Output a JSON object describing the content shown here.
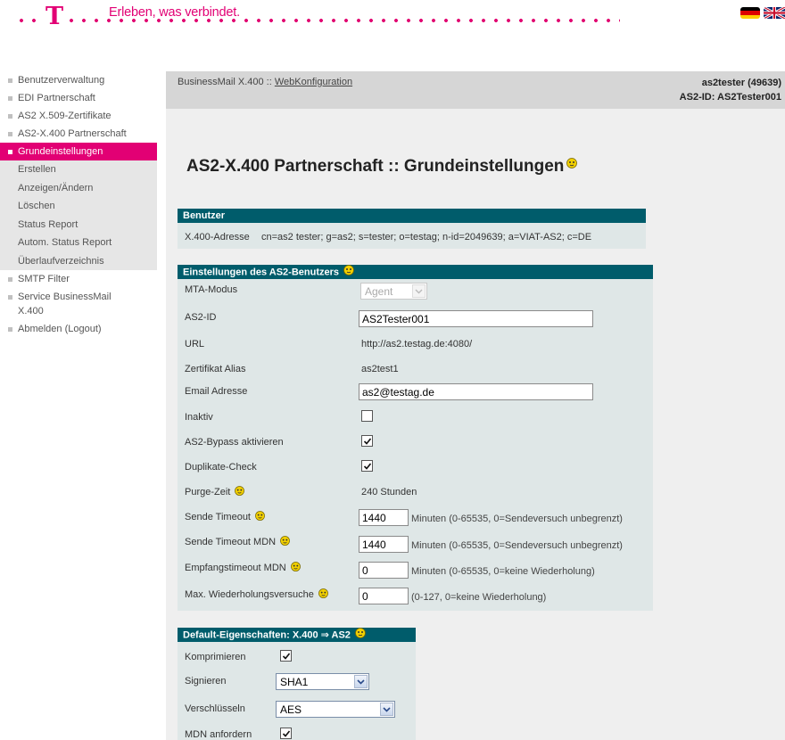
{
  "header": {
    "logo_letter": "T",
    "slogan": "Erleben, was verbindet.",
    "lang_flags": [
      "de-flag-icon",
      "uk-flag-icon"
    ]
  },
  "sidebar": {
    "items": [
      {
        "label": "Benutzerverwaltung"
      },
      {
        "label": "EDI Partnerschaft"
      },
      {
        "label": "AS2 X.509-Zertifikate"
      },
      {
        "label": "AS2-X.400 Partnerschaft"
      },
      {
        "label": "Grundeinstellungen",
        "active": true
      }
    ],
    "subitems": [
      "Erstellen",
      "Anzeigen/Ändern",
      "Löschen",
      "Status Report",
      "Autom. Status Report",
      "Überlaufverzeichnis"
    ],
    "items_after": [
      {
        "label": "SMTP Filter"
      },
      {
        "label_line1": "Service BusinessMail",
        "label_line2": "X.400"
      },
      {
        "label": "Abmelden (Logout)"
      }
    ]
  },
  "topbar": {
    "crumb_prefix": "BusinessMail X.400 :: ",
    "crumb_link": "WebKonfiguration",
    "user": "as2tester (49639)",
    "as2_id": "AS2-ID: AS2Tester001"
  },
  "page_title": "AS2-X.400 Partnerschaft :: Grundeinstellungen",
  "benutzer": {
    "title": "Benutzer",
    "label": "X.400-Adresse",
    "value": "cn=as2 tester; g=as2; s=tester; o=testag; n-id=2049639; a=VIAT-AS2; c=DE"
  },
  "as2_settings": {
    "title": "Einstellungen des AS2-Benutzers",
    "mta_modus": {
      "label": "MTA-Modus",
      "value": "Agent"
    },
    "as2_id": {
      "label": "AS2-ID",
      "value": "AS2Tester001"
    },
    "url": {
      "label": "URL",
      "value": "http://as2.testag.de:4080/"
    },
    "cert_alias": {
      "label": "Zertifikat Alias",
      "value": "as2test1"
    },
    "email": {
      "label": "Email Adresse",
      "value": "as2@testag.de"
    },
    "inaktiv": {
      "label": "Inaktiv",
      "checked": false
    },
    "bypass": {
      "label": "AS2-Bypass aktivieren",
      "checked": true
    },
    "dup_check": {
      "label": "Duplikate-Check",
      "checked": true
    },
    "purge": {
      "label": "Purge-Zeit",
      "value": "240 Stunden"
    },
    "send_timeout": {
      "label": "Sende Timeout",
      "value": "1440",
      "hint": "Minuten (0-65535, 0=Sendeversuch unbegrenzt)"
    },
    "send_timeout_mdn": {
      "label": "Sende Timeout MDN",
      "value": "1440",
      "hint": "Minuten (0-65535, 0=Sendeversuch unbegrenzt)"
    },
    "recv_timeout_mdn": {
      "label": "Empfangstimeout MDN",
      "value": "0",
      "hint": "Minuten (0-65535, 0=keine Wiederholung)"
    },
    "max_retries": {
      "label": "Max. Wiederholungsversuche",
      "value": "0",
      "hint": "(0-127, 0=keine Wiederholung)"
    }
  },
  "defaults": {
    "title": "Default-Eigenschaften: X.400 ⇒ AS2",
    "compress": {
      "label": "Komprimieren",
      "checked": true
    },
    "sign": {
      "label": "Signieren",
      "value": "SHA1"
    },
    "encrypt": {
      "label": "Verschlüsseln",
      "value": "AES"
    },
    "mdn": {
      "label": "MDN anfordern",
      "checked": true
    }
  },
  "colors": {
    "magenta": "#e20074",
    "section_header": "#005c6b",
    "section_bg": "#dfe7e7"
  }
}
